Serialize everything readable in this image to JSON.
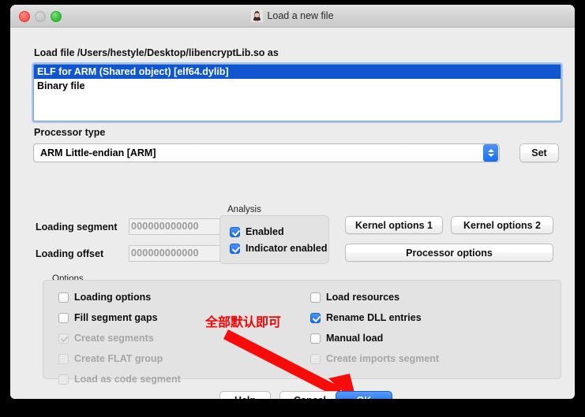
{
  "window": {
    "title": "Load a new file",
    "app_icon": "ida-pro-icon",
    "traffic_lights": {
      "close": "close-button",
      "minimize": "minimize-button",
      "maximize": "maximize-button"
    }
  },
  "file_section": {
    "label": "Load file /Users/hestyle/Desktop/libencryptLib.so as",
    "file_path": "/Users/hestyle/Desktop/libencryptLib.so",
    "options": [
      {
        "label": "ELF for ARM (Shared object) [elf64.dylib]",
        "selected": true
      },
      {
        "label": "Binary file",
        "selected": false
      }
    ]
  },
  "processor": {
    "label": "Processor type",
    "value": "ARM Little-endian [ARM]",
    "set_label": "Set"
  },
  "loading": {
    "segment_label": "Loading segment",
    "segment_value": "000000000000",
    "offset_label": "Loading offset",
    "offset_value": "000000000000"
  },
  "analysis": {
    "title": "Analysis",
    "items": [
      {
        "label": "Enabled",
        "checked": true,
        "disabled": false
      },
      {
        "label": "Indicator enabled",
        "checked": true,
        "disabled": false
      }
    ]
  },
  "buttons": {
    "kernel1": "Kernel options 1",
    "kernel2": "Kernel options 2",
    "processor_options": "Processor options",
    "help": "Help",
    "cancel": "Cancel",
    "ok": "OK"
  },
  "options": {
    "title": "Options",
    "left_column": [
      {
        "label": "Loading options",
        "checked": false,
        "disabled": false
      },
      {
        "label": "Fill segment gaps",
        "checked": false,
        "disabled": false
      },
      {
        "label": "Create segments",
        "checked": true,
        "disabled": true
      },
      {
        "label": "Create FLAT group",
        "checked": false,
        "disabled": true
      },
      {
        "label": "Load as code segment",
        "checked": false,
        "disabled": true
      }
    ],
    "right_column": [
      {
        "label": "Load resources",
        "checked": false,
        "disabled": false
      },
      {
        "label": "Rename DLL entries",
        "checked": true,
        "disabled": false
      },
      {
        "label": "Manual load",
        "checked": false,
        "disabled": false
      },
      {
        "label": "Create imports segment",
        "checked": false,
        "disabled": true
      }
    ]
  },
  "annotation": {
    "text": "全部默认即可",
    "color": "#ff0000",
    "arrow": "red-arrow-pointing-to-ok-button"
  },
  "colors": {
    "selection_blue": "#0f56d0",
    "accent_blue": "#1a6ef0",
    "dialog_bg": "#ececec",
    "annotation_red": "#ff0000"
  }
}
